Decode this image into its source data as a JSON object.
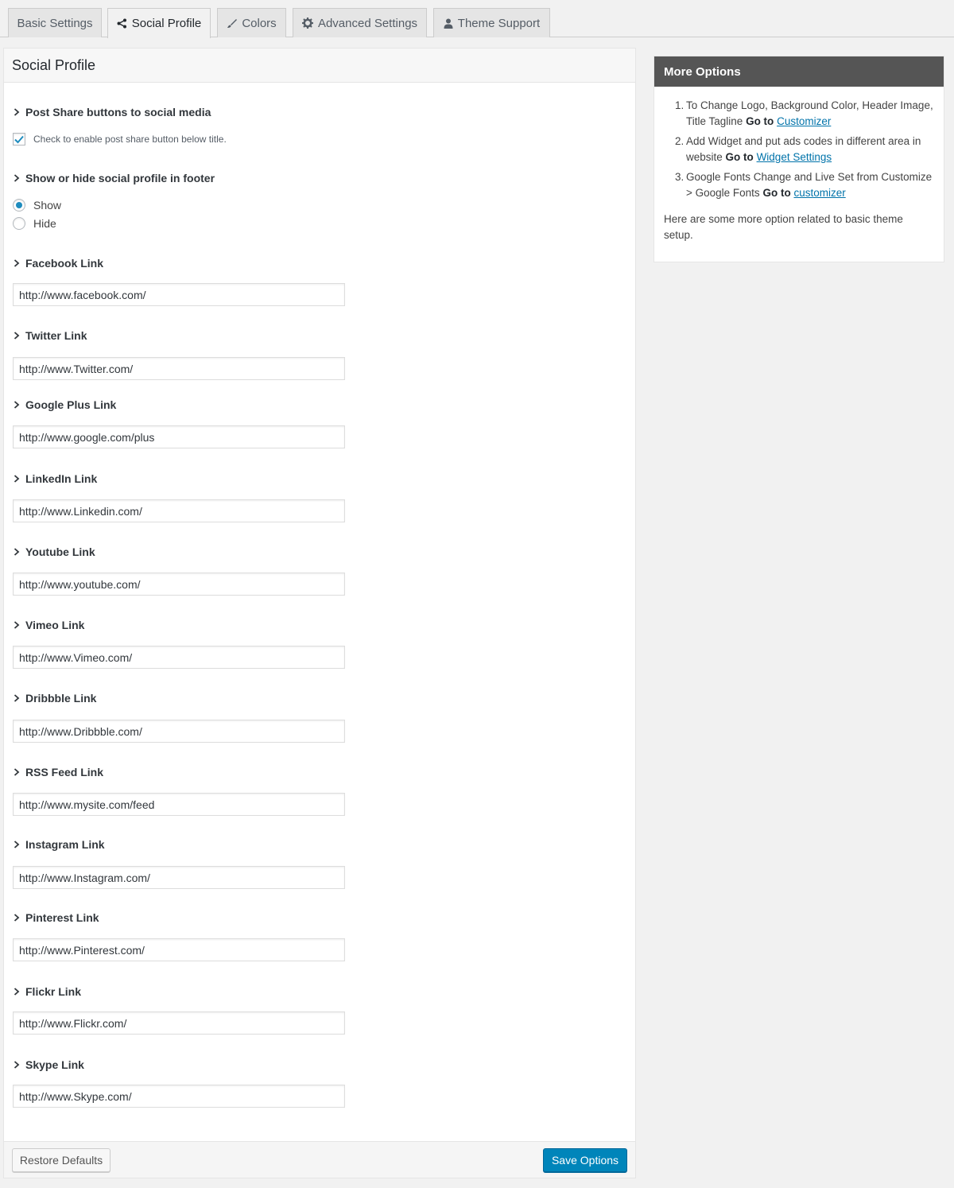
{
  "tabs": [
    {
      "label": "Basic Settings",
      "icon": "",
      "active": false
    },
    {
      "label": "Social Profile",
      "icon": "share-icon",
      "active": true
    },
    {
      "label": "Colors",
      "icon": "brush-icon",
      "active": false
    },
    {
      "label": "Advanced Settings",
      "icon": "gear-icon",
      "active": false
    },
    {
      "label": "Theme Support",
      "icon": "user-icon",
      "active": false
    }
  ],
  "panel": {
    "title": "Social Profile",
    "post_share": {
      "label": "Post Share buttons to social media",
      "checkbox_label": "Check to enable post share button below title.",
      "checked": true
    },
    "footer_profile": {
      "label": "Show or hide social profile in footer",
      "options": [
        "Show",
        "Hide"
      ],
      "selected": "Show"
    },
    "links": [
      {
        "label": "Facebook Link",
        "value": "http://www.facebook.com/"
      },
      {
        "label": "Twitter Link",
        "value": "http://www.Twitter.com/"
      },
      {
        "label": "Google Plus Link",
        "value": "http://www.google.com/plus"
      },
      {
        "label": "LinkedIn Link",
        "value": "http://www.Linkedin.com/"
      },
      {
        "label": "Youtube Link",
        "value": "http://www.youtube.com/"
      },
      {
        "label": "Vimeo Link",
        "value": "http://www.Vimeo.com/"
      },
      {
        "label": "Dribbble Link",
        "value": "http://www.Dribbble.com/"
      },
      {
        "label": "RSS Feed Link",
        "value": "http://www.mysite.com/feed"
      },
      {
        "label": "Instagram Link",
        "value": "http://www.Instagram.com/"
      },
      {
        "label": "Pinterest Link",
        "value": "http://www.Pinterest.com/"
      },
      {
        "label": "Flickr Link",
        "value": "http://www.Flickr.com/"
      },
      {
        "label": "Skype Link",
        "value": "http://www.Skype.com/"
      }
    ],
    "restore_label": "Restore Defaults",
    "save_label": "Save Options"
  },
  "sidebar": {
    "title": "More Options",
    "items": [
      {
        "num": "1.",
        "text": "To Change Logo, Background Color, Header Image, Title Tagline",
        "go": "Go to",
        "link": "Customizer"
      },
      {
        "num": "2.",
        "text": "Add Widget and put ads codes in different area in website",
        "go": "Go to",
        "link": "Widget Settings"
      },
      {
        "num": "3.",
        "text": "Google Fonts Change and Live Set from Customize > Google Fonts",
        "go": "Go to",
        "link": "customizer"
      }
    ],
    "note": "Here are some more option related to basic theme setup."
  },
  "colors": {
    "primary": "#0085ba",
    "link": "#0073aa",
    "sidebar_header": "#555555",
    "radio_dot": "#1e8cbe"
  }
}
